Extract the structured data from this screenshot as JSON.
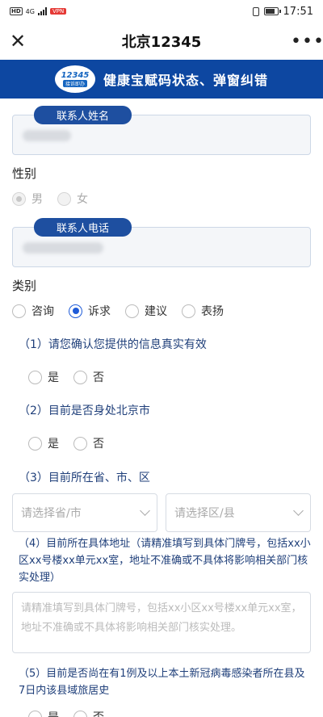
{
  "status_bar": {
    "network": "4G",
    "vpn_badge": "VPN",
    "time": "17:51"
  },
  "nav": {
    "title": "北京12345",
    "close_icon": "close-icon",
    "more_icon": "more-icon"
  },
  "banner": {
    "logo_number": "12345",
    "logo_caption": "接诉即办",
    "title": "健康宝赋码状态、弹窗纠错"
  },
  "form": {
    "contact_name": {
      "label": "联系人姓名"
    },
    "gender": {
      "label": "性别",
      "options": [
        "男",
        "女"
      ]
    },
    "contact_phone": {
      "label": "联系人电话"
    },
    "category": {
      "label": "类别",
      "options": [
        "咨询",
        "诉求",
        "建议",
        "表扬"
      ],
      "selected": "诉求"
    },
    "q1": {
      "text": "（1）请您确认您提供的信息真实有效",
      "options": [
        "是",
        "否"
      ]
    },
    "q2": {
      "text": "（2）目前是否身处北京市",
      "options": [
        "是",
        "否"
      ]
    },
    "q3": {
      "text": "（3）目前所在省、市、区",
      "province_placeholder": "请选择省/市",
      "district_placeholder": "请选择区/县"
    },
    "q4": {
      "text": "（4）目前所在具体地址（请精准填写到具体门牌号，包括xx小区xx号楼xx单元xx室，地址不准确或不具体将影响相关部门核实处理）",
      "placeholder": "请精准填写到具体门牌号，包括xx小区xx号楼xx单元xx室，地址不准确或不具体将影响相关部门核实处理。"
    },
    "q5": {
      "text": "（5）目前是否尚在有1例及以上本土新冠病毒感染者所在县及7日内该县域旅居史",
      "options": [
        "是",
        "否"
      ]
    }
  },
  "colors": {
    "banner_bg": "#0d47a1",
    "tag_bg": "#1e4fa0",
    "radio_selected": "#1e5bd8"
  }
}
